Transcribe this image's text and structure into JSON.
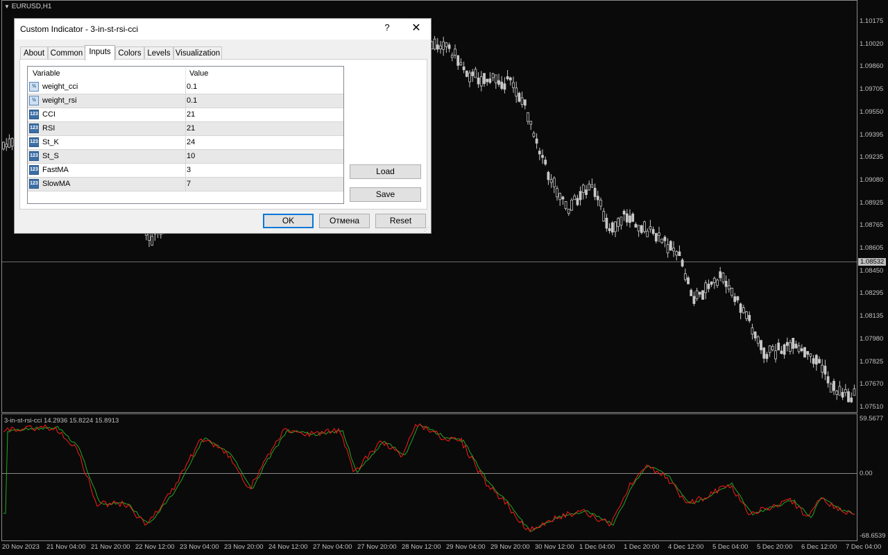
{
  "chart": {
    "symbol": "EURUSD,H1",
    "current_price": "1.08532",
    "price_axis": [
      "1.10175",
      "1.10020",
      "1.09860",
      "1.09705",
      "1.09550",
      "1.09395",
      "1.09235",
      "1.09080",
      "1.08925",
      "1.08765",
      "1.08605",
      "1.08450",
      "1.08295",
      "1.08135",
      "1.07980",
      "1.07825",
      "1.07670",
      "1.07510"
    ],
    "indicator_label": "3-in-st-rsi-cci 14.2936 15.8224 15.8913",
    "indicator_axis": [
      "59.5677",
      "0.00",
      "-68.6539"
    ],
    "time_axis": [
      "20 Nov 2023",
      "21 Nov 04:00",
      "21 Nov 20:00",
      "22 Nov 12:00",
      "23 Nov 04:00",
      "23 Nov 20:00",
      "24 Nov 12:00",
      "27 Nov 04:00",
      "27 Nov 20:00",
      "28 Nov 12:00",
      "29 Nov 04:00",
      "29 Nov 20:00",
      "30 Nov 12:00",
      "1 Dec 04:00",
      "1 Dec 20:00",
      "4 Dec 12:00",
      "5 Dec 04:00",
      "5 Dec 20:00",
      "6 Dec 12:00",
      "7 Dec 04:00"
    ],
    "colors": {
      "background": "#0a0a0a",
      "candles": "#c8c8c8",
      "line_main": "#ff1a1a",
      "line_signal": "#22aa22"
    }
  },
  "dialog": {
    "title": "Custom Indicator - 3-in-st-rsi-cci",
    "help": "?",
    "close": "✕",
    "tabs": [
      "About",
      "Common",
      "Inputs",
      "Colors",
      "Levels",
      "Visualization"
    ],
    "active_tab": "Inputs",
    "grid": {
      "headers": [
        "Variable",
        "Value"
      ],
      "rows": [
        {
          "icon": "½",
          "name": "weight_cci",
          "value": "0.1"
        },
        {
          "icon": "½",
          "name": "weight_rsi",
          "value": "0.1"
        },
        {
          "icon": "123",
          "name": "CCI",
          "value": "21"
        },
        {
          "icon": "123",
          "name": "RSI",
          "value": "21"
        },
        {
          "icon": "123",
          "name": "St_K",
          "value": "24"
        },
        {
          "icon": "123",
          "name": "St_S",
          "value": "10"
        },
        {
          "icon": "123",
          "name": "FastMA",
          "value": "3"
        },
        {
          "icon": "123",
          "name": "SlowMA",
          "value": "7"
        }
      ]
    },
    "buttons": {
      "load": "Load",
      "save": "Save",
      "ok": "OK",
      "cancel": "Отмена",
      "reset": "Reset"
    }
  }
}
